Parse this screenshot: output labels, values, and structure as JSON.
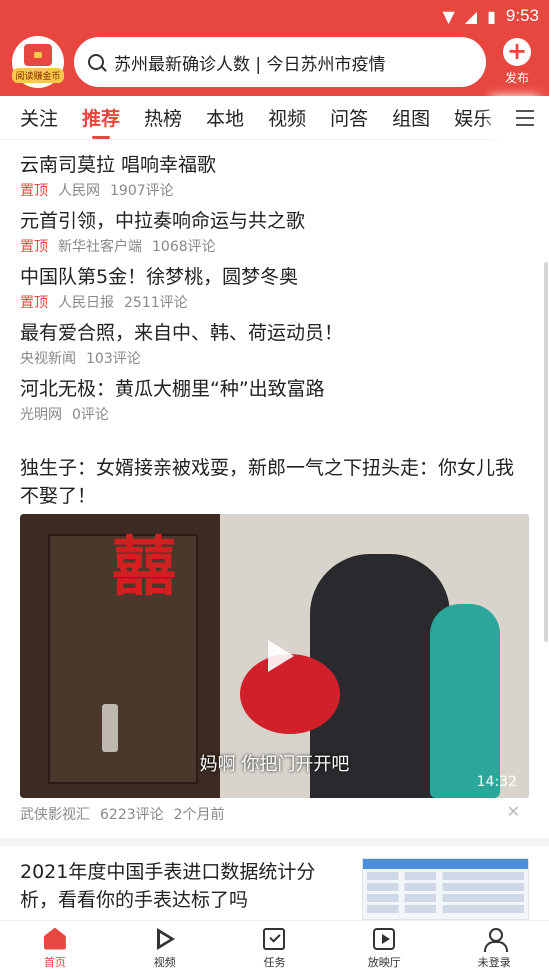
{
  "status_bar": {
    "time": "9:53"
  },
  "header": {
    "logo_label": "阅读赚金币",
    "search_text": "苏州最新确诊人数 | 今日苏州市疫情",
    "publish_label": "发布"
  },
  "tabs": [
    "关注",
    "推荐",
    "热榜",
    "本地",
    "视频",
    "问答",
    "组图",
    "娱乐"
  ],
  "news": [
    {
      "title": "云南司莫拉 唱响幸福歌",
      "pin": "置顶",
      "source": "人民网",
      "comments": "1907评论"
    },
    {
      "title": "元首引领，中拉奏响命运与共之歌",
      "pin": "置顶",
      "source": "新华社客户端",
      "comments": "1068评论"
    },
    {
      "title": "中国队第5金！徐梦桃，圆梦冬奥",
      "pin": "置顶",
      "source": "人民日报",
      "comments": "2511评论"
    },
    {
      "title": "最有爱合照，来自中、韩、荷运动员！",
      "pin": "",
      "source": "央视新闻",
      "comments": "103评论"
    },
    {
      "title": "河北无极：黄瓜大棚里“种”出致富路",
      "pin": "",
      "source": "光明网",
      "comments": "0评论"
    }
  ],
  "video_post": {
    "title": "独生子：女婿接亲被戏耍，新郎一气之下扭头走：你女儿我不娶了！",
    "xi_char": "囍",
    "subtitle": "妈啊 你把门开开吧",
    "duration": "14:32",
    "source": "武侠影视汇",
    "comments": "6223评论",
    "time": "2个月前"
  },
  "article_post": {
    "title": "2021年度中国手表进口数据统计分析，看看你的手表达标了吗"
  },
  "bottom_nav": [
    "首页",
    "视频",
    "任务",
    "放映厅",
    "未登录"
  ],
  "colors": {
    "accent": "#e8473f"
  }
}
